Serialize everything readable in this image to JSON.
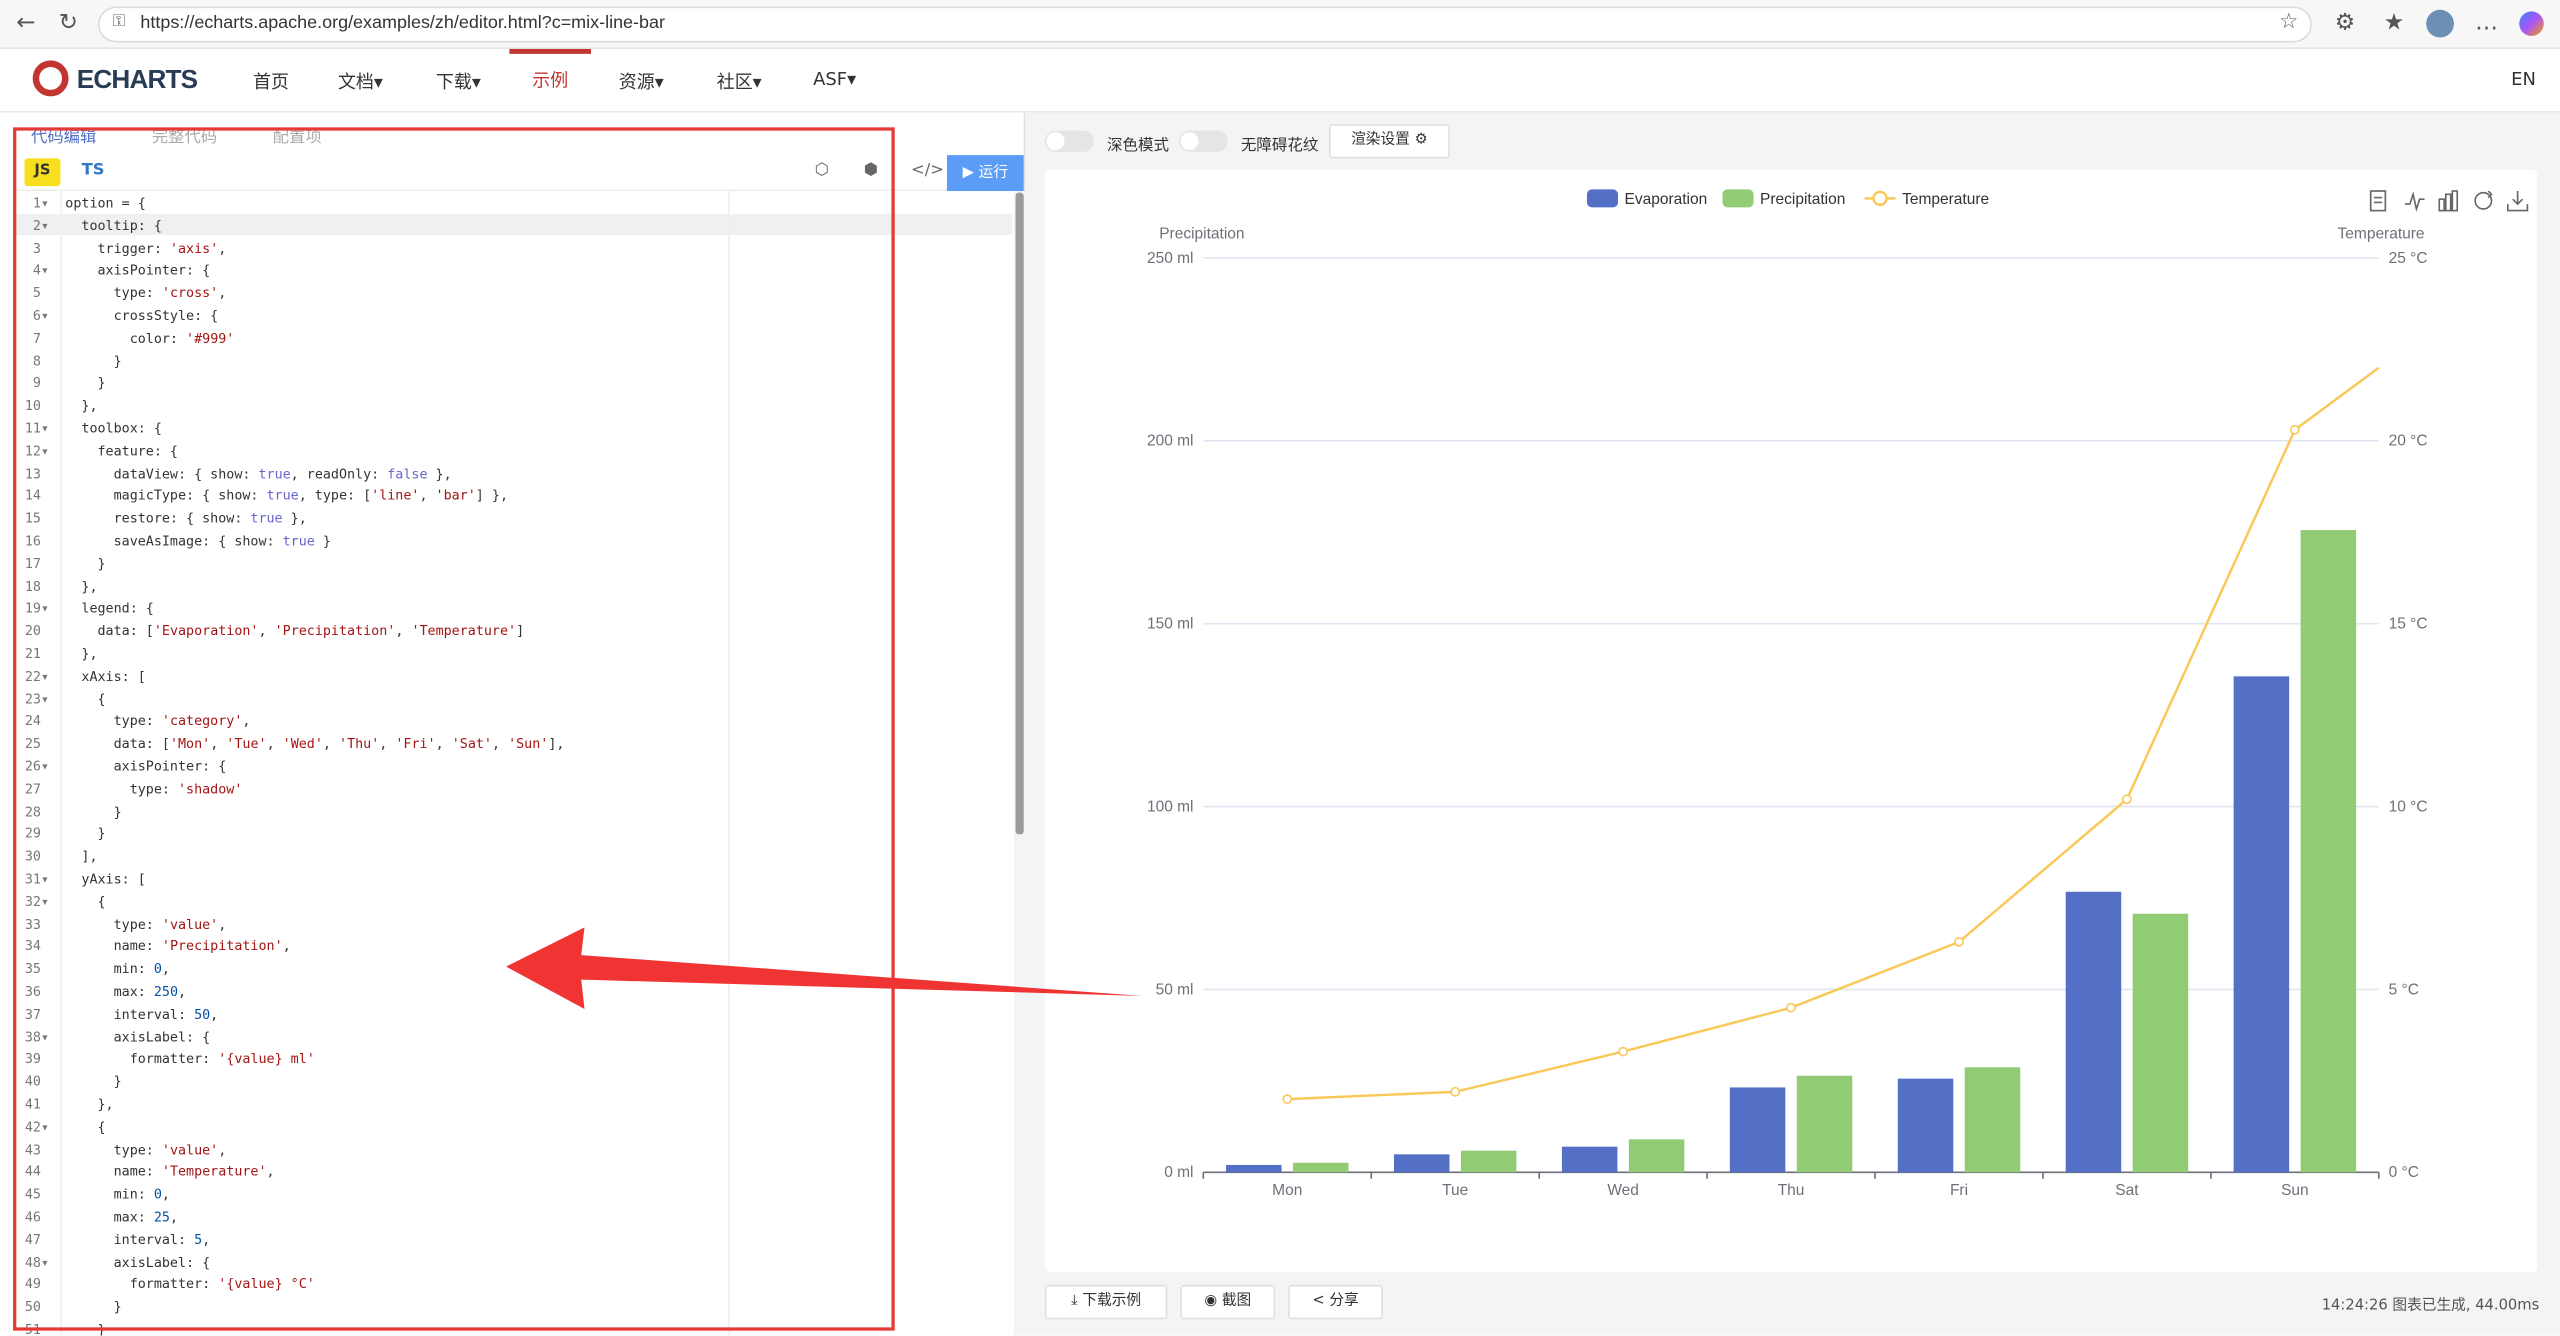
{
  "browser": {
    "url": "https://echarts.apache.org/examples/zh/editor.html?c=mix-line-bar",
    "back_icon": "back-arrow-icon",
    "reload_icon": "reload-icon"
  },
  "site": {
    "logo_text": "ECHARTS",
    "nav": [
      "首页",
      "文档",
      "下载",
      "示例",
      "资源",
      "社区",
      "ASF"
    ],
    "active_nav": "示例",
    "lang": "EN",
    "brand_color": "#c23531"
  },
  "editor": {
    "tabs": [
      "代码编辑",
      "完整代码",
      "配置项"
    ],
    "lang_js": "JS",
    "lang_ts": "TS",
    "run_label": "运行",
    "code_lines": [
      [
        {
          "t": "option = {"
        }
      ],
      [
        {
          "t": "  tooltip: {"
        }
      ],
      [
        {
          "t": "    trigger: "
        },
        {
          "t": "'axis'",
          "c": "cs"
        },
        {
          "t": ","
        }
      ],
      [
        {
          "t": "    axisPointer: {"
        }
      ],
      [
        {
          "t": "      type: "
        },
        {
          "t": "'cross'",
          "c": "cs"
        },
        {
          "t": ","
        }
      ],
      [
        {
          "t": "      crossStyle: {"
        }
      ],
      [
        {
          "t": "        color: "
        },
        {
          "t": "'#999'",
          "c": "cs"
        }
      ],
      [
        {
          "t": "      }"
        }
      ],
      [
        {
          "t": "    }"
        }
      ],
      [
        {
          "t": "  },"
        }
      ],
      [
        {
          "t": "  toolbox: {"
        }
      ],
      [
        {
          "t": "    feature: {"
        }
      ],
      [
        {
          "t": "      dataView: { show: "
        },
        {
          "t": "true",
          "c": "ck"
        },
        {
          "t": ", readOnly: "
        },
        {
          "t": "false",
          "c": "ck"
        },
        {
          "t": " },"
        }
      ],
      [
        {
          "t": "      magicType: { show: "
        },
        {
          "t": "true",
          "c": "ck"
        },
        {
          "t": ", type: ["
        },
        {
          "t": "'line'",
          "c": "cs"
        },
        {
          "t": ", "
        },
        {
          "t": "'bar'",
          "c": "cs"
        },
        {
          "t": "] },"
        }
      ],
      [
        {
          "t": "      restore: { show: "
        },
        {
          "t": "true",
          "c": "ck"
        },
        {
          "t": " },"
        }
      ],
      [
        {
          "t": "      saveAsImage: { show: "
        },
        {
          "t": "true",
          "c": "ck"
        },
        {
          "t": " }"
        }
      ],
      [
        {
          "t": "    }"
        }
      ],
      [
        {
          "t": "  },"
        }
      ],
      [
        {
          "t": "  legend: {"
        }
      ],
      [
        {
          "t": "    data: ["
        },
        {
          "t": "'Evaporation'",
          "c": "cs"
        },
        {
          "t": ", "
        },
        {
          "t": "'Precipitation'",
          "c": "cs"
        },
        {
          "t": ", "
        },
        {
          "t": "'Temperature'",
          "c": "cs"
        },
        {
          "t": "]"
        }
      ],
      [
        {
          "t": "  },"
        }
      ],
      [
        {
          "t": "  xAxis: ["
        }
      ],
      [
        {
          "t": "    {"
        }
      ],
      [
        {
          "t": "      type: "
        },
        {
          "t": "'category'",
          "c": "cs"
        },
        {
          "t": ","
        }
      ],
      [
        {
          "t": "      data: ["
        },
        {
          "t": "'Mon'",
          "c": "cs"
        },
        {
          "t": ", "
        },
        {
          "t": "'Tue'",
          "c": "cs"
        },
        {
          "t": ", "
        },
        {
          "t": "'Wed'",
          "c": "cs"
        },
        {
          "t": ", "
        },
        {
          "t": "'Thu'",
          "c": "cs"
        },
        {
          "t": ", "
        },
        {
          "t": "'Fri'",
          "c": "cs"
        },
        {
          "t": ", "
        },
        {
          "t": "'Sat'",
          "c": "cs"
        },
        {
          "t": ", "
        },
        {
          "t": "'Sun'",
          "c": "cs"
        },
        {
          "t": "],"
        }
      ],
      [
        {
          "t": "      axisPointer: {"
        }
      ],
      [
        {
          "t": "        type: "
        },
        {
          "t": "'shadow'",
          "c": "cs"
        }
      ],
      [
        {
          "t": "      }"
        }
      ],
      [
        {
          "t": "    }"
        }
      ],
      [
        {
          "t": "  ],"
        }
      ],
      [
        {
          "t": "  yAxis: ["
        }
      ],
      [
        {
          "t": "    {"
        }
      ],
      [
        {
          "t": "      type: "
        },
        {
          "t": "'value'",
          "c": "cs"
        },
        {
          "t": ","
        }
      ],
      [
        {
          "t": "      name: "
        },
        {
          "t": "'Precipitation'",
          "c": "cs"
        },
        {
          "t": ","
        }
      ],
      [
        {
          "t": "      min: "
        },
        {
          "t": "0",
          "c": "cv"
        },
        {
          "t": ","
        }
      ],
      [
        {
          "t": "      max: "
        },
        {
          "t": "250",
          "c": "cv"
        },
        {
          "t": ","
        }
      ],
      [
        {
          "t": "      interval: "
        },
        {
          "t": "50",
          "c": "cv"
        },
        {
          "t": ","
        }
      ],
      [
        {
          "t": "      axisLabel: {"
        }
      ],
      [
        {
          "t": "        formatter: "
        },
        {
          "t": "'{value} ml'",
          "c": "cs"
        }
      ],
      [
        {
          "t": "      }"
        }
      ],
      [
        {
          "t": "    },"
        }
      ],
      [
        {
          "t": "    {"
        }
      ],
      [
        {
          "t": "      type: "
        },
        {
          "t": "'value'",
          "c": "cs"
        },
        {
          "t": ","
        }
      ],
      [
        {
          "t": "      name: "
        },
        {
          "t": "'Temperature'",
          "c": "cs"
        },
        {
          "t": ","
        }
      ],
      [
        {
          "t": "      min: "
        },
        {
          "t": "0",
          "c": "cv"
        },
        {
          "t": ","
        }
      ],
      [
        {
          "t": "      max: "
        },
        {
          "t": "25",
          "c": "cv"
        },
        {
          "t": ","
        }
      ],
      [
        {
          "t": "      interval: "
        },
        {
          "t": "5",
          "c": "cv"
        },
        {
          "t": ","
        }
      ],
      [
        {
          "t": "      axisLabel: {"
        }
      ],
      [
        {
          "t": "        formatter: "
        },
        {
          "t": "'{value} °C'",
          "c": "cs"
        }
      ],
      [
        {
          "t": "      }"
        }
      ],
      [
        {
          "t": "    }"
        }
      ]
    ],
    "fold_lines": [
      1,
      2,
      4,
      6,
      11,
      12,
      19,
      22,
      23,
      26,
      31,
      32,
      38,
      42,
      48
    ]
  },
  "toolbar": {
    "dark_mode_label": "深色模式",
    "decal_label": "无障碍花纹",
    "render_settings_label": "渲染设置"
  },
  "bottom": {
    "download_label": "下载示例",
    "screenshot_label": "截图",
    "share_label": "分享",
    "status_time": "14:24:26",
    "status_text": "图表已生成, 44.00ms"
  },
  "chart_data": {
    "type": "bar",
    "categories": [
      "Mon",
      "Tue",
      "Wed",
      "Thu",
      "Fri",
      "Sat",
      "Sun"
    ],
    "series": [
      {
        "name": "Evaporation",
        "type": "bar",
        "color": "#5470c6",
        "values": [
          2.0,
          4.9,
          7.0,
          23.2,
          25.6,
          76.7,
          135.6
        ]
      },
      {
        "name": "Precipitation",
        "type": "bar",
        "color": "#91cc75",
        "values": [
          2.6,
          5.9,
          9.0,
          26.4,
          28.7,
          70.7,
          175.6
        ]
      },
      {
        "name": "Temperature",
        "type": "line",
        "color": "#fac858",
        "yAxisIndex": 1,
        "values": [
          2.0,
          2.2,
          3.3,
          4.5,
          6.3,
          10.2,
          20.3
        ]
      }
    ],
    "extra_point": {
      "value": 22
    },
    "y_left": {
      "name": "Precipitation",
      "min": 0,
      "max": 250,
      "interval": 50,
      "unit": "ml",
      "labels": [
        "0 ml",
        "50 ml",
        "100 ml",
        "150 ml",
        "200 ml",
        "250 ml"
      ]
    },
    "y_right": {
      "name": "Temperature",
      "min": 0,
      "max": 25,
      "interval": 5,
      "unit": "°C",
      "labels": [
        "0 °C",
        "5 °C",
        "10 °C",
        "15 °C",
        "20 °C",
        "25 °C"
      ]
    },
    "legend": [
      "Evaporation",
      "Precipitation",
      "Temperature"
    ],
    "legend_position": "top-center",
    "grid": true
  },
  "annotation": {
    "highlight_color": "#e53935"
  }
}
